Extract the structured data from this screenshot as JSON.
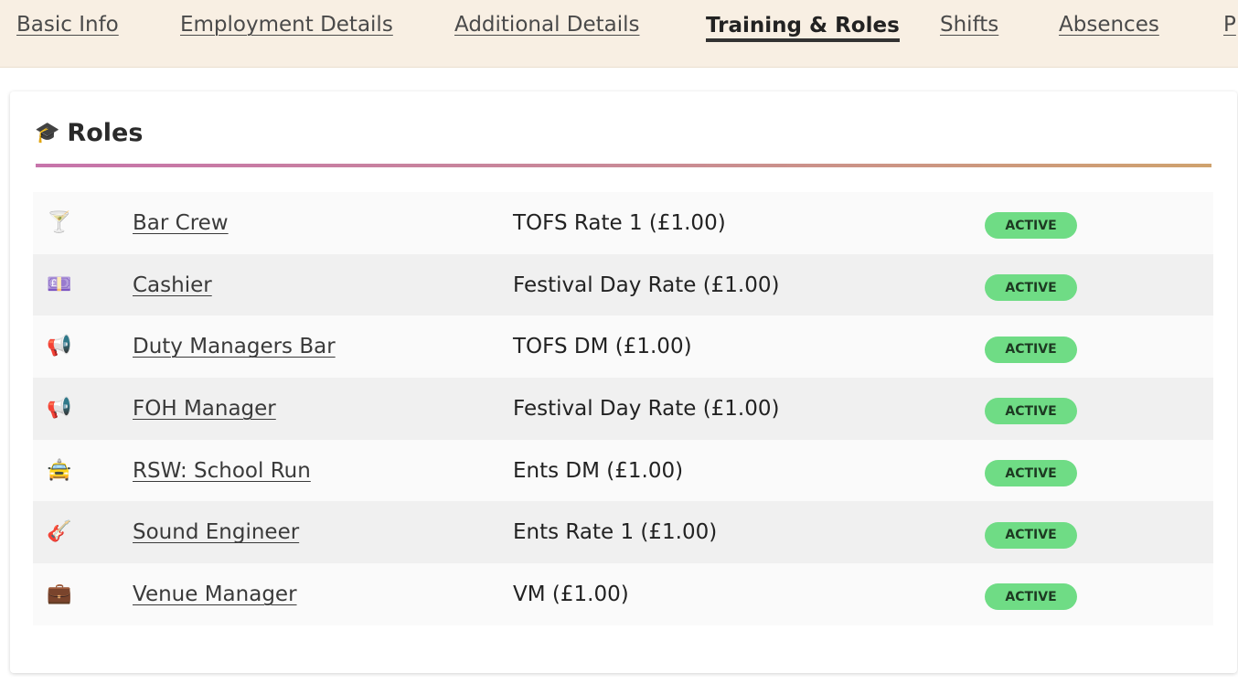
{
  "tabs": [
    {
      "label": "Basic Info",
      "active": false
    },
    {
      "label": "Employment Details",
      "active": false
    },
    {
      "label": "Additional Details",
      "active": false
    },
    {
      "label": "Training & Roles",
      "active": true
    },
    {
      "label": "Shifts",
      "active": false
    },
    {
      "label": "Absences",
      "active": false
    },
    {
      "label": "P",
      "active": false
    }
  ],
  "roles_card": {
    "icon": "🎓",
    "title": "Roles"
  },
  "roles": [
    {
      "icon": "🍸",
      "icon_name": "cocktail-glass-icon",
      "name": "Bar Crew",
      "rate": "TOFS Rate 1 (£1.00)",
      "status": "ACTIVE"
    },
    {
      "icon": "💷",
      "icon_name": "money-icon",
      "name": "Cashier",
      "rate": "Festival Day Rate (£1.00)",
      "status": "ACTIVE"
    },
    {
      "icon": "📢",
      "icon_name": "megaphone-icon",
      "name": "Duty Managers Bar",
      "rate": "TOFS DM (£1.00)",
      "status": "ACTIVE"
    },
    {
      "icon": "📢",
      "icon_name": "megaphone-icon",
      "name": "FOH Manager",
      "rate": "Festival Day Rate (£1.00)",
      "status": "ACTIVE"
    },
    {
      "icon": "🚖",
      "icon_name": "taxi-icon",
      "name": "RSW: School Run",
      "rate": "Ents DM (£1.00)",
      "status": "ACTIVE"
    },
    {
      "icon": "🎸",
      "icon_name": "guitar-icon",
      "name": "Sound Engineer",
      "rate": "Ents Rate 1 (£1.00)",
      "status": "ACTIVE"
    },
    {
      "icon": "💼",
      "icon_name": "briefcase-icon",
      "name": "Venue Manager",
      "rate": "VM (£1.00)",
      "status": "ACTIVE"
    }
  ],
  "colors": {
    "tabbar_bg": "#f8efe3",
    "badge_active": "#6fdc85",
    "divider_start": "#c774ab",
    "divider_end": "#cfa26e"
  }
}
